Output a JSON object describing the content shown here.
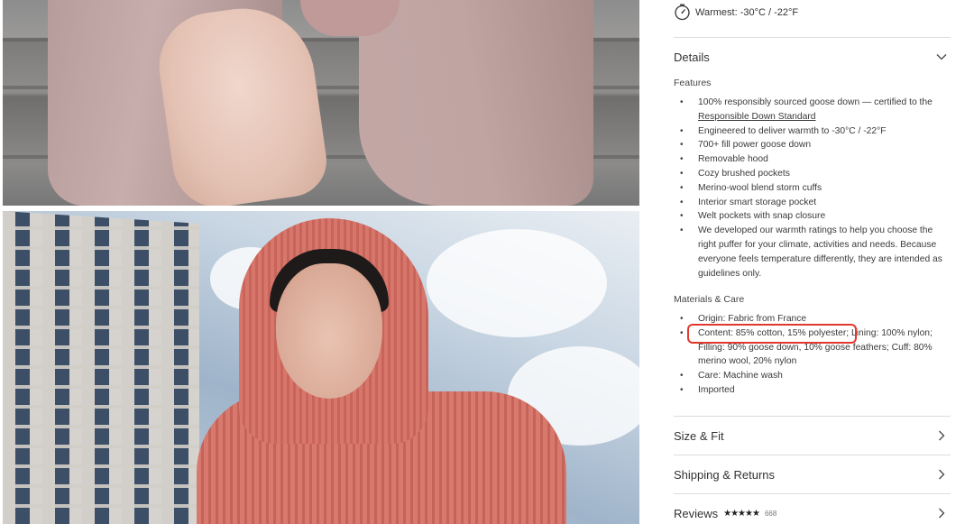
{
  "warmth": {
    "icon": "thermometer-dial-icon",
    "text": "Warmest: -30°C / -22°F"
  },
  "details": {
    "title": "Details",
    "icon": "chevron-down-icon",
    "features_label": "Features",
    "features": [
      {
        "text": "100% responsibly sourced goose down — certified to the",
        "link": "Responsible Down Standard"
      },
      {
        "text": "Engineered to deliver warmth to -30°C / -22°F"
      },
      {
        "text": "700+ fill power goose down"
      },
      {
        "text": "Removable hood"
      },
      {
        "text": "Cozy brushed pockets"
      },
      {
        "text": "Merino-wool blend storm cuffs"
      },
      {
        "text": "Interior smart storage pocket"
      },
      {
        "text": "Welt pockets with snap closure"
      },
      {
        "text": "We developed our warmth ratings to help you choose the right puffer for your climate, activities and needs. Because everyone feels temperature differently, they are intended as guidelines only."
      }
    ],
    "materials_label": "Materials & Care",
    "materials": [
      {
        "text": "Origin: Fabric from France"
      },
      {
        "highlight": "Content: 85% cotton, 15% polyester",
        "text": "; Lining: 100% nylon; Filling: 90% goose down, 10% goose feathers; Cuff: 80% merino wool, 20% nylon"
      },
      {
        "text": "Care: Machine wash"
      },
      {
        "text": "Imported"
      }
    ]
  },
  "sections": [
    {
      "title": "Size & Fit",
      "icon": "chevron-right-icon"
    },
    {
      "title": "Shipping & Returns",
      "icon": "chevron-right-icon"
    },
    {
      "title": "Reviews",
      "stars": "★★★★★",
      "count": "668",
      "icon": "chevron-right-icon"
    }
  ],
  "colors": {
    "highlight_border": "#e0392b",
    "divider": "#dcdcdc",
    "text": "#333333"
  }
}
